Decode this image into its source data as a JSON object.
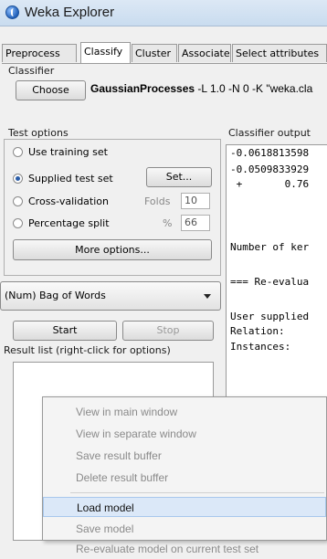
{
  "window": {
    "title": "Weka Explorer"
  },
  "tabs": [
    "Preprocess",
    "Classify",
    "Cluster",
    "Associate",
    "Select attributes"
  ],
  "active_tab": "Classify",
  "classifier": {
    "group_label": "Classifier",
    "choose_label": "Choose",
    "name": "GaussianProcesses",
    "args": " -L 1.0 -N 0 -K \"weka.cla"
  },
  "test_options": {
    "group_label": "Test options",
    "use_training_set": "Use training set",
    "supplied_test_set": "Supplied test set",
    "set_button": "Set...",
    "cross_validation": "Cross-validation",
    "folds_label": "Folds",
    "folds_value": "10",
    "percentage_split": "Percentage split",
    "percent_label": "%",
    "percent_value": "66",
    "more_options": "More options..."
  },
  "target": {
    "selected": "(Num) Bag of Words"
  },
  "actions": {
    "start": "Start",
    "stop": "Stop"
  },
  "result_list": {
    "label": "Result list (right-click for options)"
  },
  "output": {
    "label": "Classifier output",
    "lines": [
      "-0.0618813598",
      "-0.0509833929",
      " +       0.76",
      "",
      "",
      "",
      "Number of ker",
      "",
      "=== Re-evalua",
      "",
      "User supplied",
      "Relation:",
      "Instances:"
    ]
  },
  "context_menu": {
    "items": [
      {
        "label": "View in main window",
        "enabled": false
      },
      {
        "label": "View in separate window",
        "enabled": false
      },
      {
        "label": "Save result buffer",
        "enabled": false
      },
      {
        "label": "Delete result buffer",
        "enabled": false
      },
      {
        "label": "Load model",
        "enabled": true
      },
      {
        "label": "Save model",
        "enabled": false
      },
      {
        "label": "Re-evaluate model on current test set",
        "enabled": false
      }
    ]
  }
}
